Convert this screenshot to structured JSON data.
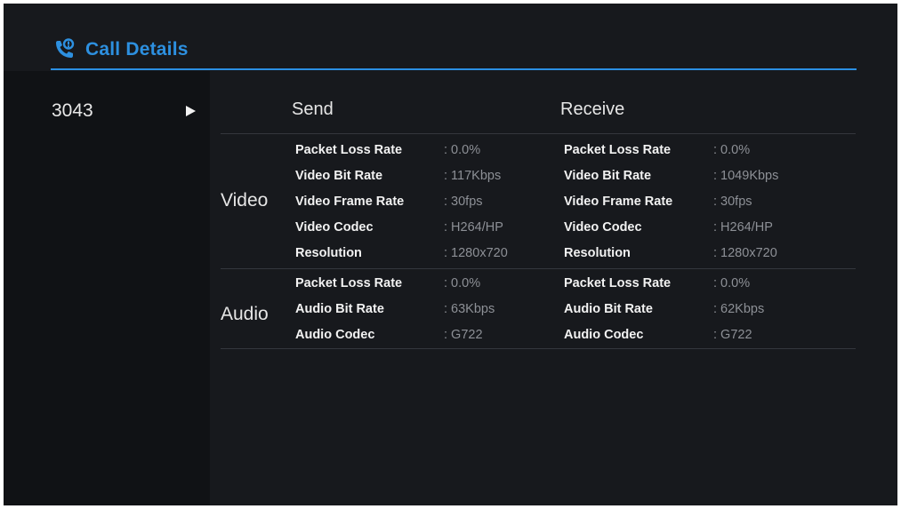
{
  "header": {
    "title": "Call Details",
    "icon": "phone-call-icon"
  },
  "sidebar": {
    "call_number": "3043",
    "arrow_icon": "play-arrow-icon"
  },
  "table": {
    "send_header": "Send",
    "receive_header": "Receive",
    "video": {
      "label": "Video",
      "rows": [
        {
          "send_label": "Packet Loss Rate",
          "send_value": ": 0.0%",
          "receive_label": "Packet Loss Rate",
          "receive_value": ": 0.0%"
        },
        {
          "send_label": "Video Bit Rate",
          "send_value": ": 117Kbps",
          "receive_label": "Video Bit Rate",
          "receive_value": ": 1049Kbps"
        },
        {
          "send_label": "Video Frame Rate",
          "send_value": ": 30fps",
          "receive_label": "Video Frame Rate",
          "receive_value": ": 30fps"
        },
        {
          "send_label": "Video Codec",
          "send_value": ": H264/HP",
          "receive_label": "Video Codec",
          "receive_value": ": H264/HP"
        },
        {
          "send_label": "Resolution",
          "send_value": ": 1280x720",
          "receive_label": "Resolution",
          "receive_value": ": 1280x720"
        }
      ]
    },
    "audio": {
      "label": "Audio",
      "rows": [
        {
          "send_label": "Packet Loss Rate",
          "send_value": ": 0.0%",
          "receive_label": "Packet Loss Rate",
          "receive_value": ": 0.0%"
        },
        {
          "send_label": "Audio Bit Rate",
          "send_value": ": 63Kbps",
          "receive_label": "Audio Bit Rate",
          "receive_value": ": 62Kbps"
        },
        {
          "send_label": "Audio Codec",
          "send_value": ": G722",
          "receive_label": "Audio Codec",
          "receive_value": ": G722"
        }
      ]
    }
  },
  "colors": {
    "accent": "#2d90e0",
    "background": "#17191d",
    "sidebar_background": "#101215",
    "label_text": "#f2f2f2",
    "value_text": "#8d9096"
  }
}
